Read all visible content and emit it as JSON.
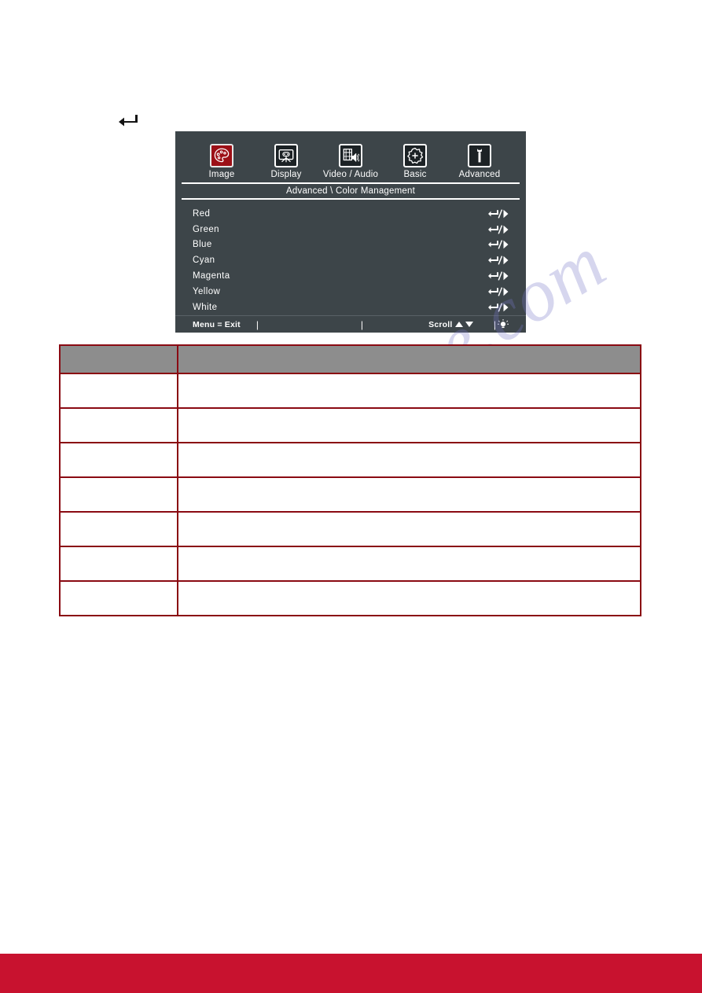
{
  "page": {
    "return_arrow_icon": "return-arrow-icon",
    "watermark": "manualshive.com",
    "footer_bar_color": "#c8122f"
  },
  "osd": {
    "panel_color": "#3d4549",
    "selected_tab_color": "#9c1017",
    "tabs": [
      {
        "label": "Image",
        "icon": "color-palette-icon",
        "selected": true
      },
      {
        "label": "Display",
        "icon": "display-screen-icon",
        "selected": false
      },
      {
        "label": "Video / Audio",
        "icon": "video-audio-icon",
        "selected": false
      },
      {
        "label": "Basic",
        "icon": "gear-plus-icon",
        "selected": false
      },
      {
        "label": "Advanced",
        "icon": "wrench-icon",
        "selected": false
      }
    ],
    "breadcrumb": "Advanced \\ Color Management",
    "items": [
      {
        "label": "Red",
        "adjust_icon": "enter-adjust-icon"
      },
      {
        "label": "Green",
        "adjust_icon": "enter-adjust-icon"
      },
      {
        "label": "Blue",
        "adjust_icon": "enter-adjust-icon"
      },
      {
        "label": "Cyan",
        "adjust_icon": "enter-adjust-icon"
      },
      {
        "label": "Magenta",
        "adjust_icon": "enter-adjust-icon"
      },
      {
        "label": "Yellow",
        "adjust_icon": "enter-adjust-icon"
      },
      {
        "label": "White",
        "adjust_icon": "enter-adjust-icon"
      }
    ],
    "footer": {
      "exit": "Menu = Exit",
      "separator": "|",
      "scroll": "Scroll",
      "scroll_up_icon": "triangle-up-icon",
      "scroll_down_icon": "triangle-down-icon",
      "lamp_icon": "lamp-icon"
    }
  },
  "spec_table": {
    "border_color": "#8a0a12",
    "header_bg": "#8d8d8d",
    "headers": [
      "",
      ""
    ],
    "rows": [
      [
        "",
        ""
      ],
      [
        "",
        ""
      ],
      [
        "",
        ""
      ],
      [
        "",
        ""
      ],
      [
        "",
        ""
      ],
      [
        "",
        ""
      ],
      [
        "",
        ""
      ]
    ]
  }
}
